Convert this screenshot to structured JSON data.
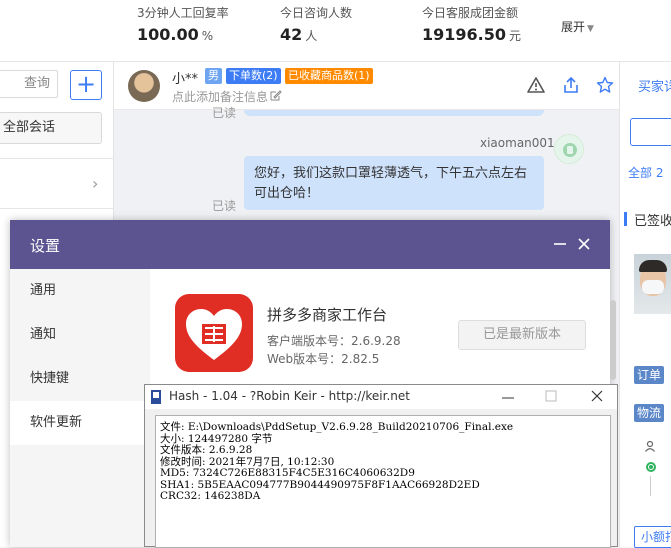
{
  "stats": [
    {
      "label": "3分钟人工回复率",
      "value": "100.00",
      "unit": "%"
    },
    {
      "label": "今日咨询人数",
      "value": "42",
      "unit": "人"
    },
    {
      "label": "今日客服成团金额",
      "value": "19196.50",
      "unit": "元"
    }
  ],
  "stats_expand": "展开",
  "left": {
    "search_label": "查询",
    "add_label": "+",
    "all_sessions": "全部会话"
  },
  "chat": {
    "customer_name": "小**",
    "tags": {
      "gender": "男",
      "orders": "下单数(2)",
      "favorites": "已收藏商品数(1)"
    },
    "note_placeholder": "点此添加备注信息",
    "read_label_top": "已读",
    "agent_name": "xiaoman001",
    "message": "您好，我们这款口罩轻薄透气，下午五六点左右可出仓哈！",
    "read_label": "已读"
  },
  "right": {
    "buyer_tab": "买家详",
    "all_count": "全部 2",
    "signed": "已签收",
    "order_badge": "订单",
    "logistics_badge": "物流",
    "small_amount": "小额打"
  },
  "settings": {
    "title": "设置",
    "nav": [
      "通用",
      "通知",
      "快捷键",
      "软件更新"
    ],
    "active_nav": "软件更新",
    "app_name": "拼多多商家工作台",
    "client_version": "客户端版本号：2.6.9.28",
    "web_version": "Web版本号：2.82.5",
    "latest_button": "已是最新版本",
    "colors": {
      "title_bar": "#5b5490",
      "logo": "#e02e24"
    }
  },
  "hash": {
    "title": "Hash - 1.04 - ?Robin Keir - http://keir.net",
    "lines": [
      "文件: E:\\Downloads\\PddSetup_V2.6.9.28_Build20210706_Final.exe",
      "大小: 124497280 字节",
      "文件版本: 2.6.9.28",
      "修改时间: 2021年7月7日, 10:12:30",
      "MD5: 7324C726E88315F4C5E316C4060632D9",
      "SHA1: 5B5EAAC094777B9044490975F8F1AAC66928D2ED",
      "CRC32: 146238DA"
    ]
  },
  "colors": {
    "accent": "#3d7cf5",
    "orange": "#ff8a00"
  }
}
